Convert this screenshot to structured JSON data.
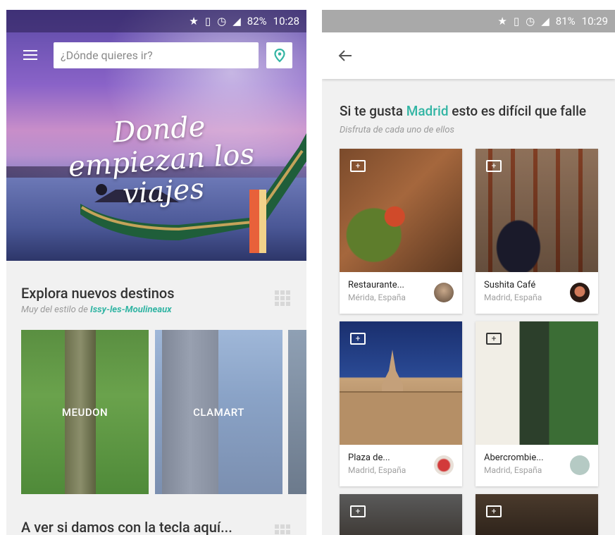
{
  "status_bar_left": {
    "battery": "82%",
    "time": "10:28"
  },
  "status_bar_right": {
    "battery": "81%",
    "time": "10:29"
  },
  "search": {
    "placeholder": "¿Dónde quieres ir?"
  },
  "hero": {
    "title": "Donde empiezan los viajes"
  },
  "explore": {
    "title": "Explora nuevos destinos",
    "subtitle_prefix": "Muy del estilo de ",
    "subtitle_link": "Issy-les-Moulineaux",
    "destinations": [
      "MEUDON",
      "CLAMART"
    ]
  },
  "next_section": {
    "title": "A ver si damos con la tecla aquí..."
  },
  "recommend": {
    "title_prefix": "Si te gusta ",
    "title_city": "Madrid",
    "title_suffix": " esto es difícil que falle",
    "subtitle": "Disfruta de cada uno de ellos"
  },
  "places": [
    {
      "name": "Restaurante...",
      "location": "Mérida, España"
    },
    {
      "name": "Sushita Café",
      "location": "Madrid, España"
    },
    {
      "name": "Plaza de...",
      "location": "Madrid, España"
    },
    {
      "name": "Abercrombie...",
      "location": "Madrid, España"
    }
  ],
  "colors": {
    "accent": "#33b5a4",
    "text": "#333333",
    "muted": "#9a9a9a"
  },
  "icons": [
    "star-icon",
    "vibrate-icon",
    "alarm-icon",
    "signal-icon",
    "menu-icon",
    "location-pin-icon",
    "grid-icon",
    "back-arrow-icon",
    "folder-add-icon"
  ]
}
